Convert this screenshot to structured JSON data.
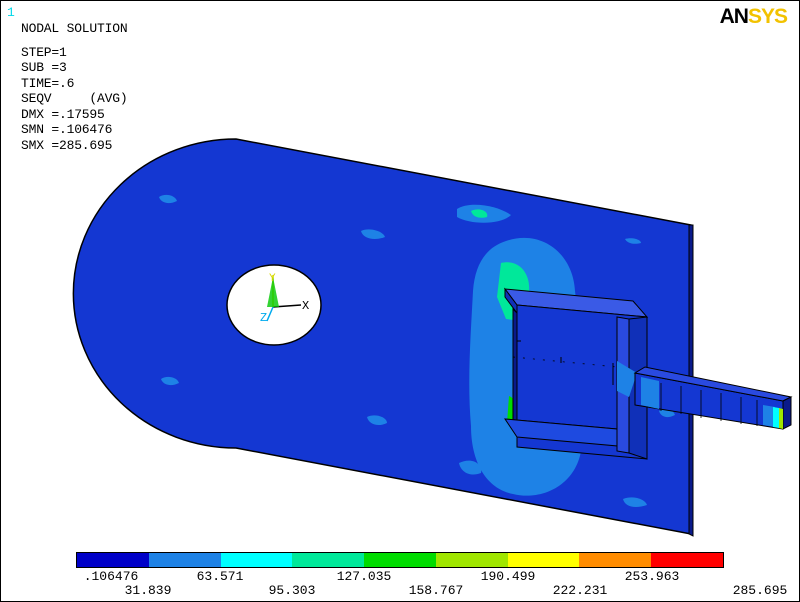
{
  "window_number": "1",
  "info_lines": [
    "NODAL SOLUTION",
    "STEP=1",
    "SUB =3",
    "TIME=.6",
    "SEQV     (AVG)",
    "DMX =.17595",
    "SMN =.106476",
    "SMX =285.695"
  ],
  "logo": {
    "part1": "AN",
    "part2": "SYS"
  },
  "triad": {
    "y": "Y",
    "x": "X",
    "z": "Z"
  },
  "legend": {
    "colors": [
      "#0000c8",
      "#1e82e6",
      "#00ffff",
      "#00e89a",
      "#00dc00",
      "#a0e600",
      "#ffff00",
      "#ff8c00",
      "#ff0000"
    ],
    "labels_top": [
      ".106476",
      "63.571",
      "127.035",
      "190.499",
      "253.963"
    ],
    "labels_bottom": [
      "31.839",
      "95.303",
      "158.767",
      "222.231",
      "285.695"
    ]
  },
  "colors": {
    "plate": "#1437d2",
    "edge": "#000000",
    "background": "#ffffff"
  }
}
